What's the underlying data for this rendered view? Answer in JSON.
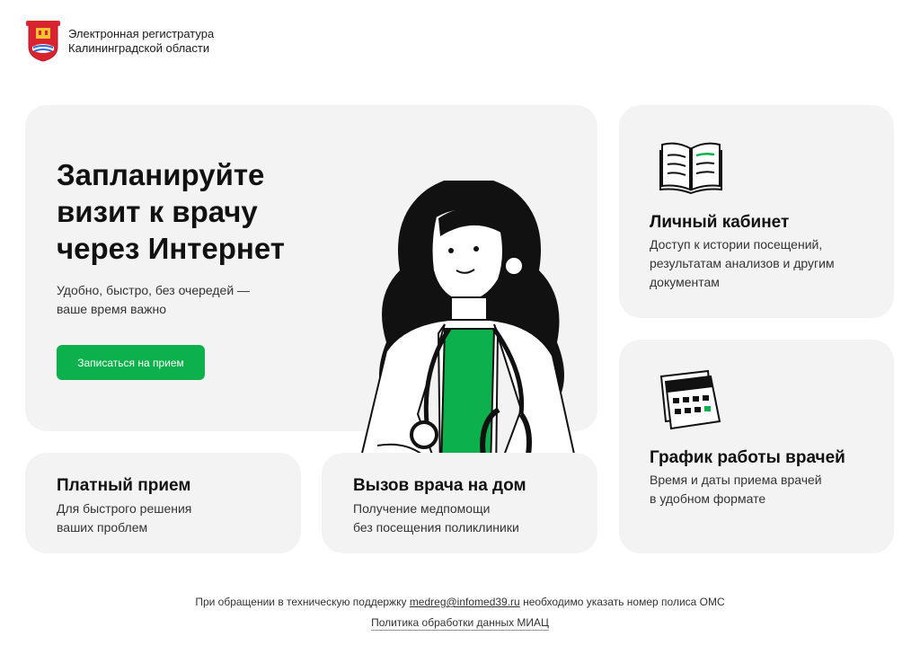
{
  "header": {
    "line1": "Электронная регистратура",
    "line2": "Калининградской области"
  },
  "hero": {
    "title_1": "Запланируйте",
    "title_2": "визит к врачу",
    "title_3": "через Интернет",
    "sub_1": "Удобно, быстро, без очередей —",
    "sub_2": "ваше время важно",
    "button": "Записаться на прием"
  },
  "cabinet": {
    "title": "Личный кабинет",
    "text_1": "Доступ к истории посещений,",
    "text_2": "результатам анализов и другим",
    "text_3": "документам"
  },
  "schedule": {
    "title": "График работы врачей",
    "text_1": "Время и даты приема врачей",
    "text_2": "в удобном формате"
  },
  "paid": {
    "title": "Платный прием",
    "text_1": "Для быстрого решения",
    "text_2": "ваших проблем"
  },
  "home_visit": {
    "title": "Вызов врача на дом",
    "text_1": "Получение медпомощи",
    "text_2": "без посещения поликлиники"
  },
  "footer": {
    "before": "При обращении в техническую поддержку ",
    "email": "medreg@infomed39.ru",
    "after": " необходимо указать номер полиса ОМС",
    "policy": "Политика обработки данных МИАЦ"
  },
  "colors": {
    "accent": "#0cb14b",
    "card": "#f3f3f4"
  },
  "icons": {
    "logo": "coat-of-arms-icon",
    "cabinet": "open-book-icon",
    "schedule": "calendar-icon"
  }
}
